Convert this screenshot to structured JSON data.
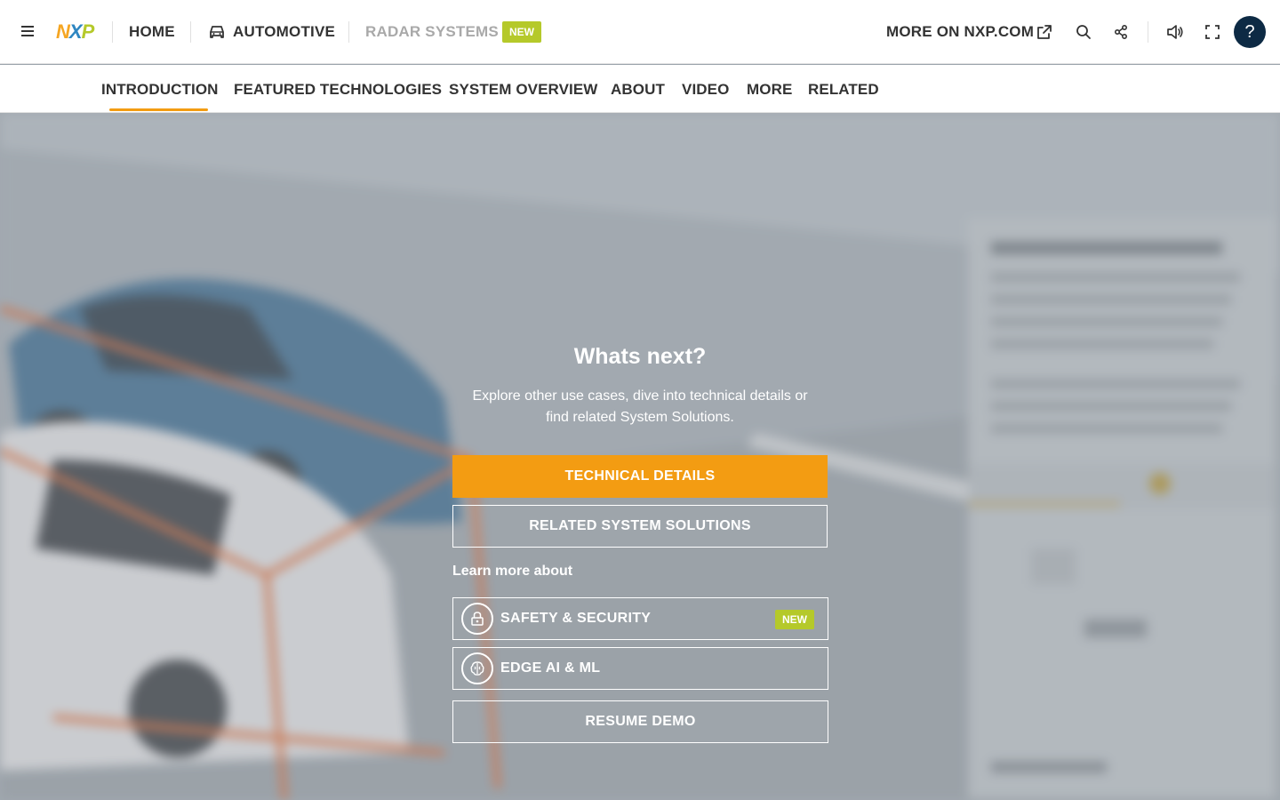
{
  "header": {
    "logo_text": "NXP",
    "home": "HOME",
    "automotive": "AUTOMOTIVE",
    "radar_systems": "RADAR SYSTEMS",
    "new_badge": "NEW",
    "more_on": "MORE ON NXP.COM",
    "help": "?"
  },
  "tabs": [
    "INTRODUCTION",
    "FEATURED TECHNOLOGIES",
    "SYSTEM OVERVIEW",
    "ABOUT",
    "VIDEO",
    "MORE",
    "RELATED"
  ],
  "active_tab": "INTRODUCTION",
  "panel": {
    "title": "Whats next?",
    "subtitle_line1": "Explore other use cases, dive into technical details or",
    "subtitle_line2": "find related System Solutions.",
    "technical_details": "TECHNICAL DETAILS",
    "related_solutions": "RELATED SYSTEM SOLUTIONS",
    "learn_more": "Learn more about",
    "safety": "SAFETY & SECURITY",
    "safety_badge": "NEW",
    "edge_ai": "EDGE AI & ML",
    "resume": "RESUME DEMO"
  },
  "colors": {
    "accent": "#f39c12",
    "badge": "#b5c92a",
    "help_bg": "#0d2a44",
    "logo_n": "#f5a623",
    "logo_x": "#7a9a3a",
    "logo_p": "#b5c92a"
  }
}
